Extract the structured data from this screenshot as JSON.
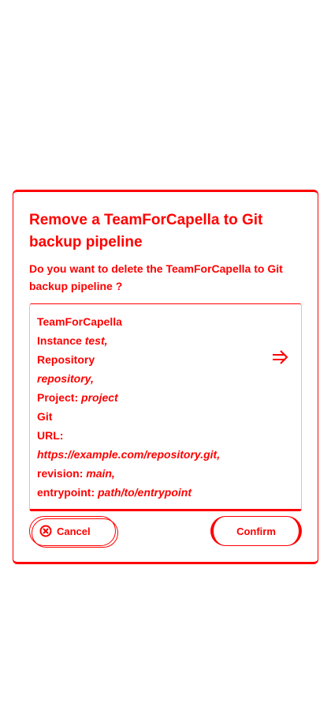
{
  "dialog": {
    "title": "Remove a TeamForCapella to Git backup pipeline",
    "question": "Do you want to delete the TeamForCapella to Git backup pipeline ?",
    "details": {
      "t4c_heading": "TeamForCapella",
      "instance_label": "Instance",
      "instance_value": "test,",
      "repository_label": "Repository",
      "repository_value": "repository,",
      "project_label": "Project:",
      "project_value": "project",
      "git_heading": "Git",
      "url_label": "URL:",
      "url_value": "https://example.com/repository.git,",
      "revision_label": "revision:",
      "revision_value": "main,",
      "entrypoint_label": "entrypoint:",
      "entrypoint_value": "path/to/entrypoint"
    },
    "arrow_icon": "arrow-right-icon",
    "cancel_label": "Cancel",
    "cancel_icon": "cancel-icon",
    "confirm_label": "Confirm",
    "accent_color": "#ff0000"
  }
}
